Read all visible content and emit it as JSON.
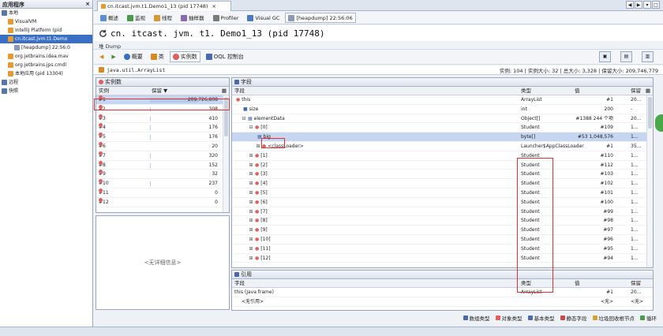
{
  "left_panel": {
    "title": "应用程序",
    "close": "×",
    "items": [
      {
        "label": "本地",
        "indent": 0,
        "color": "#5577aa",
        "selected": false
      },
      {
        "label": "VisualVM",
        "indent": 1,
        "color": "#e89a30",
        "selected": false
      },
      {
        "label": "IntelliJ Platform (pid",
        "indent": 1,
        "color": "#e89a30",
        "selected": false
      },
      {
        "label": "cn.itcast.jvm.t1.Demo",
        "indent": 1,
        "color": "#e89a30",
        "selected": true
      },
      {
        "label": "[heapdump] 22:56:0",
        "indent": 2,
        "color": "#8899bb",
        "selected": false
      },
      {
        "label": "org.jetbrains.idea.mav",
        "indent": 1,
        "color": "#e89a30",
        "selected": false
      },
      {
        "label": "org.jetbrains.jps.cmdl",
        "indent": 1,
        "color": "#e89a30",
        "selected": false
      },
      {
        "label": "本地应用 (pid 13304)",
        "indent": 1,
        "color": "#e89a30",
        "selected": false
      },
      {
        "label": "远程",
        "indent": 0,
        "color": "#5577aa",
        "selected": false
      },
      {
        "label": "快照",
        "indent": 0,
        "color": "#5577aa",
        "selected": false
      }
    ]
  },
  "doc_tab": {
    "label": "cn.itcast.jvm.t1.Demo1_13 (pid 17748)",
    "close": "×"
  },
  "subtabs": [
    {
      "label": "概述",
      "color": "#5a8fd8",
      "active": false
    },
    {
      "label": "监视",
      "color": "#4a9a4a",
      "active": false
    },
    {
      "label": "线程",
      "color": "#d89a30",
      "active": false
    },
    {
      "label": "抽样器",
      "color": "#8a6ab0",
      "active": false
    },
    {
      "label": "Profiler",
      "color": "#7a7a7a",
      "active": false
    },
    {
      "label": "Visual GC",
      "color": "#4a7ac8",
      "active": false
    },
    {
      "label": "[heapdump] 22:56:06",
      "color": "#8899bb",
      "active": true
    }
  ],
  "title": "cn. itcast. jvm. t1. Demo1_13 (pid 17748)",
  "heap_label": "堆 Dump",
  "toolbar": {
    "back": "◀",
    "forward": "▶",
    "summary": "概要",
    "classes": "类",
    "instances": "实例数",
    "oql": "OQL 控制台",
    "right_icons": [
      "▣",
      "▤",
      "▥"
    ]
  },
  "class_bar": {
    "class_name": "java.util.ArrayList",
    "stats": "实例: 104  |  实例大小: 32  |  总大小: 3,328  |  保留大小: 209,746,779"
  },
  "instances_panel": {
    "title": "实例数",
    "col_instance": "实例",
    "col_retained": "保留 ▼",
    "rows": [
      {
        "name": "#1",
        "retained": "209,726,808",
        "bar": 1.0
      },
      {
        "name": "#2",
        "retained": "308",
        "bar": 0.02
      },
      {
        "name": "#3",
        "retained": "410",
        "bar": 0.02
      },
      {
        "name": "#4",
        "retained": "176",
        "bar": 0.01
      },
      {
        "name": "#5",
        "retained": "176",
        "bar": 0.01
      },
      {
        "name": "#6",
        "retained": "20",
        "bar": 0.0
      },
      {
        "name": "#7",
        "retained": "320",
        "bar": 0.02
      },
      {
        "name": "#8",
        "retained": "152",
        "bar": 0.01
      },
      {
        "name": "#9",
        "retained": "32",
        "bar": 0.0
      },
      {
        "name": "#10",
        "retained": "237",
        "bar": 0.01
      },
      {
        "name": "#11",
        "retained": "0",
        "bar": 0.0
      },
      {
        "name": "#12",
        "retained": "0",
        "bar": 0.0
      }
    ],
    "no_details": "<无详细信息>"
  },
  "fields_panel": {
    "title": "字段",
    "col_field": "字段",
    "col_type": "类型",
    "col_value": "值",
    "col_retained": "保留",
    "rows": [
      {
        "indent": 0,
        "glyph": "",
        "icon": "●",
        "name": "this",
        "type": "ArrayList",
        "value": "#1",
        "retained": "20..."
      },
      {
        "indent": 1,
        "glyph": "",
        "icon": "■",
        "name": "size",
        "type": "int",
        "value": "200",
        "retained": "-"
      },
      {
        "indent": 1,
        "glyph": "⊟",
        "icon": "▦",
        "name": "elementData",
        "type": "Object[]",
        "value": "#1388  244 个项",
        "retained": "20..."
      },
      {
        "indent": 2,
        "glyph": "⊟",
        "icon": "●",
        "name": "[0]",
        "type": "Student",
        "value": "#109",
        "retained": "1..."
      },
      {
        "indent": 3,
        "glyph": "",
        "icon": "▦",
        "name": "big",
        "type": "byte[]",
        "value": "#53  1,048,576",
        "retained": "1..."
      },
      {
        "indent": 3,
        "glyph": "⊞",
        "icon": "●",
        "name": "<classLoader>",
        "type": "Launcher$AppClassLoader",
        "value": "#1",
        "retained": "35..."
      },
      {
        "indent": 2,
        "glyph": "⊞",
        "icon": "●",
        "name": "[1]",
        "type": "Student",
        "value": "#110",
        "retained": "1..."
      },
      {
        "indent": 2,
        "glyph": "⊞",
        "icon": "●",
        "name": "[2]",
        "type": "Student",
        "value": "#112",
        "retained": "1..."
      },
      {
        "indent": 2,
        "glyph": "⊞",
        "icon": "●",
        "name": "[3]",
        "type": "Student",
        "value": "#103",
        "retained": "1..."
      },
      {
        "indent": 2,
        "glyph": "⊞",
        "icon": "●",
        "name": "[4]",
        "type": "Student",
        "value": "#102",
        "retained": "1..."
      },
      {
        "indent": 2,
        "glyph": "⊞",
        "icon": "●",
        "name": "[5]",
        "type": "Student",
        "value": "#101",
        "retained": "1..."
      },
      {
        "indent": 2,
        "glyph": "⊞",
        "icon": "●",
        "name": "[6]",
        "type": "Student",
        "value": "#100",
        "retained": "1..."
      },
      {
        "indent": 2,
        "glyph": "⊞",
        "icon": "●",
        "name": "[7]",
        "type": "Student",
        "value": "#99",
        "retained": "1..."
      },
      {
        "indent": 2,
        "glyph": "⊞",
        "icon": "●",
        "name": "[8]",
        "type": "Student",
        "value": "#98",
        "retained": "1..."
      },
      {
        "indent": 2,
        "glyph": "⊞",
        "icon": "●",
        "name": "[9]",
        "type": "Student",
        "value": "#97",
        "retained": "1..."
      },
      {
        "indent": 2,
        "glyph": "⊞",
        "icon": "●",
        "name": "[10]",
        "type": "Student",
        "value": "#96",
        "retained": "1..."
      },
      {
        "indent": 2,
        "glyph": "⊞",
        "icon": "●",
        "name": "[11]",
        "type": "Student",
        "value": "#95",
        "retained": "1..."
      },
      {
        "indent": 2,
        "glyph": "⊞",
        "icon": "●",
        "name": "[12]",
        "type": "Student",
        "value": "#94",
        "retained": "1..."
      }
    ]
  },
  "refs_panel": {
    "title": "引用",
    "col_field": "字段",
    "col_type": "类型",
    "col_value": "值",
    "col_retained": "保留",
    "rows": [
      {
        "name": "this (Java frame)",
        "type": "ArrayList",
        "value": "#1",
        "retained": "20..."
      },
      {
        "name": "<无引用>",
        "type": "",
        "value": "<无>",
        "retained": "<无>"
      }
    ]
  },
  "legend": [
    {
      "label": "数组类型",
      "color": "#4a6ab0"
    },
    {
      "label": "对象类型",
      "color": "#e06060"
    },
    {
      "label": "基本类型",
      "color": "#4a6ab0"
    },
    {
      "label": "静态字段",
      "color": "#c84a4a"
    },
    {
      "label": "垃圾回收根节点",
      "color": "#d8a030"
    },
    {
      "label": "循环",
      "color": "#4a9a4a"
    }
  ]
}
